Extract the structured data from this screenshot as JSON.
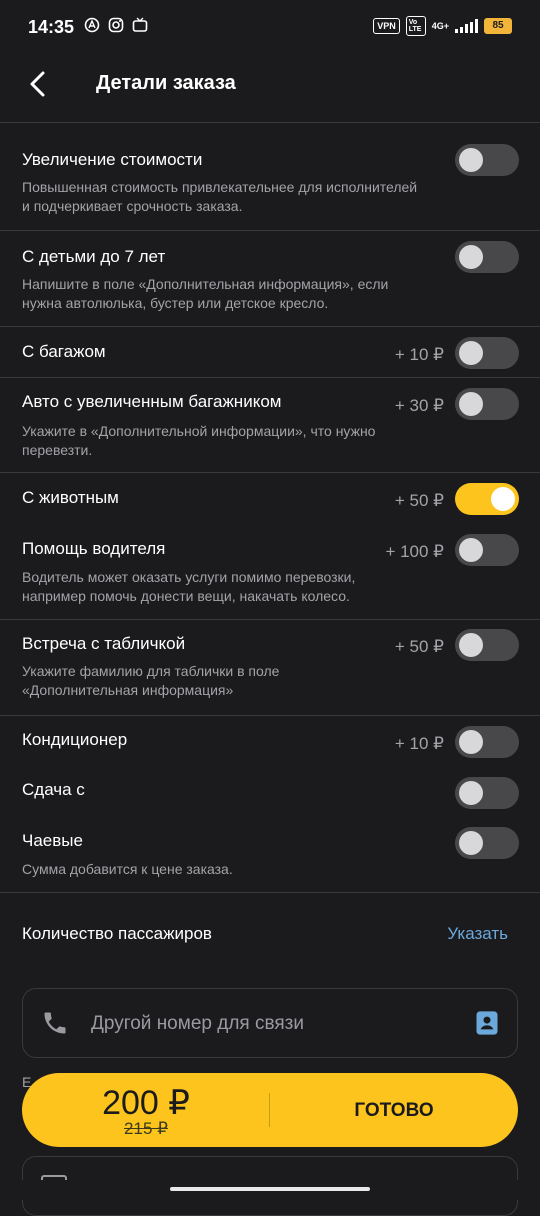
{
  "status_bar": {
    "time": "14:35",
    "vpn": "VPN",
    "volte": "Vo LTE",
    "network": "4G+",
    "battery": "85"
  },
  "header": {
    "title": "Детали заказа",
    "back_icon": "chevron-left-icon"
  },
  "options": [
    {
      "title": "Увеличение стоимости",
      "price": "",
      "desc": "Повышенная стоимость привлекательнее для исполнителей и подчеркивает срочность заказа.",
      "on": false
    },
    {
      "title": "С детьми до 7 лет",
      "price": "",
      "desc": "Напишите в поле «Дополнительная информация», если нужна автолюлька, бустер или детское кресло.",
      "on": false
    },
    {
      "title": "С багажом",
      "price": "+ 10 ₽",
      "desc": "",
      "on": false
    },
    {
      "title": "Авто с увеличенным багажником",
      "price": "+ 30 ₽",
      "desc": "Укажите в «Дополнительной информации», что нужно перевезти.",
      "on": false
    },
    {
      "title": "С животным",
      "price": "+ 50 ₽",
      "desc": "",
      "on": true
    },
    {
      "title": "Помощь водителя",
      "price": "+ 100 ₽",
      "desc": "Водитель может оказать услуги помимо перевозки, например помочь донести вещи, накачать колесо.",
      "on": false
    },
    {
      "title": "Встреча с табличкой",
      "price": "+ 50 ₽",
      "desc": "Укажите фамилию для таблички в поле «Дополнительная информация»",
      "on": false
    },
    {
      "title": "Кондиционер",
      "price": "+ 10 ₽",
      "desc": "",
      "on": false
    },
    {
      "title": "Сдача с",
      "price": "",
      "desc": "",
      "on": false
    },
    {
      "title": "Чаевые",
      "price": "",
      "desc": "Сумма добавится к цене заказа.",
      "on": false
    }
  ],
  "passengers": {
    "label": "Количество пассажиров",
    "action": "Указать"
  },
  "phone": {
    "placeholder": "Другой номер для связи",
    "icon": "phone-icon",
    "contact_icon": "contact-book-icon"
  },
  "behind_text": "Е",
  "cta": {
    "price": "200 ₽",
    "old_price": "215 ₽",
    "done_label": "ГОТОВО"
  },
  "colors": {
    "background": "#1b1b1d",
    "accent": "#fcc41c",
    "link": "#6ba8dc",
    "muted": "#a3a3a8"
  }
}
